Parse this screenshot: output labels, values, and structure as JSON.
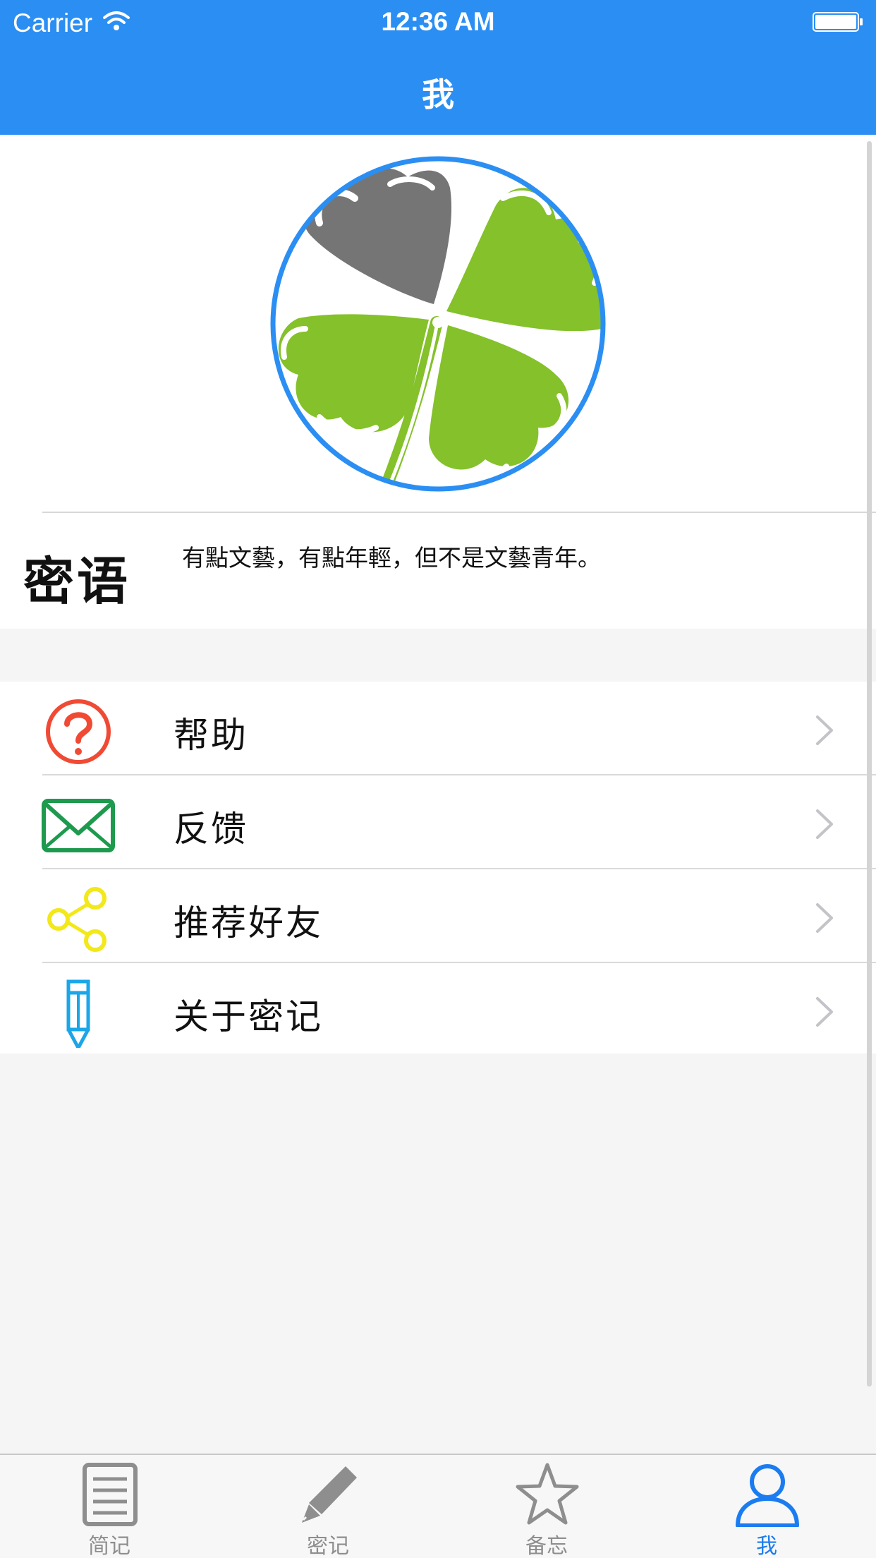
{
  "status_bar": {
    "carrier": "Carrier",
    "time": "12:36 AM"
  },
  "nav": {
    "title": "我"
  },
  "profile": {
    "avatar_icon": "four-leaf-clover-icon",
    "motto_label": "密语",
    "motto_text": "有點文藝，有點年輕，但不是文藝青年。"
  },
  "menu": {
    "items": [
      {
        "label": "帮助",
        "icon": "question-circle-icon",
        "color": "#f04a35"
      },
      {
        "label": "反馈",
        "icon": "envelope-icon",
        "color": "#1e9a4e"
      },
      {
        "label": "推荐好友",
        "icon": "share-icon",
        "color": "#f2e81a"
      },
      {
        "label": "关于密记",
        "icon": "pencil-icon",
        "color": "#1aa6e8"
      }
    ]
  },
  "tabbar": {
    "tabs": [
      {
        "label": "简记",
        "icon": "document-icon"
      },
      {
        "label": "密记",
        "icon": "pencil-icon"
      },
      {
        "label": "备忘",
        "icon": "star-icon"
      },
      {
        "label": "我",
        "icon": "person-icon",
        "active": true
      }
    ]
  },
  "colors": {
    "accent": "#2b8ef3",
    "tab_active": "#1a7cf0",
    "tab_inactive": "#8e8e8e",
    "clover_green": "#84c12a",
    "clover_gray": "#757575"
  }
}
